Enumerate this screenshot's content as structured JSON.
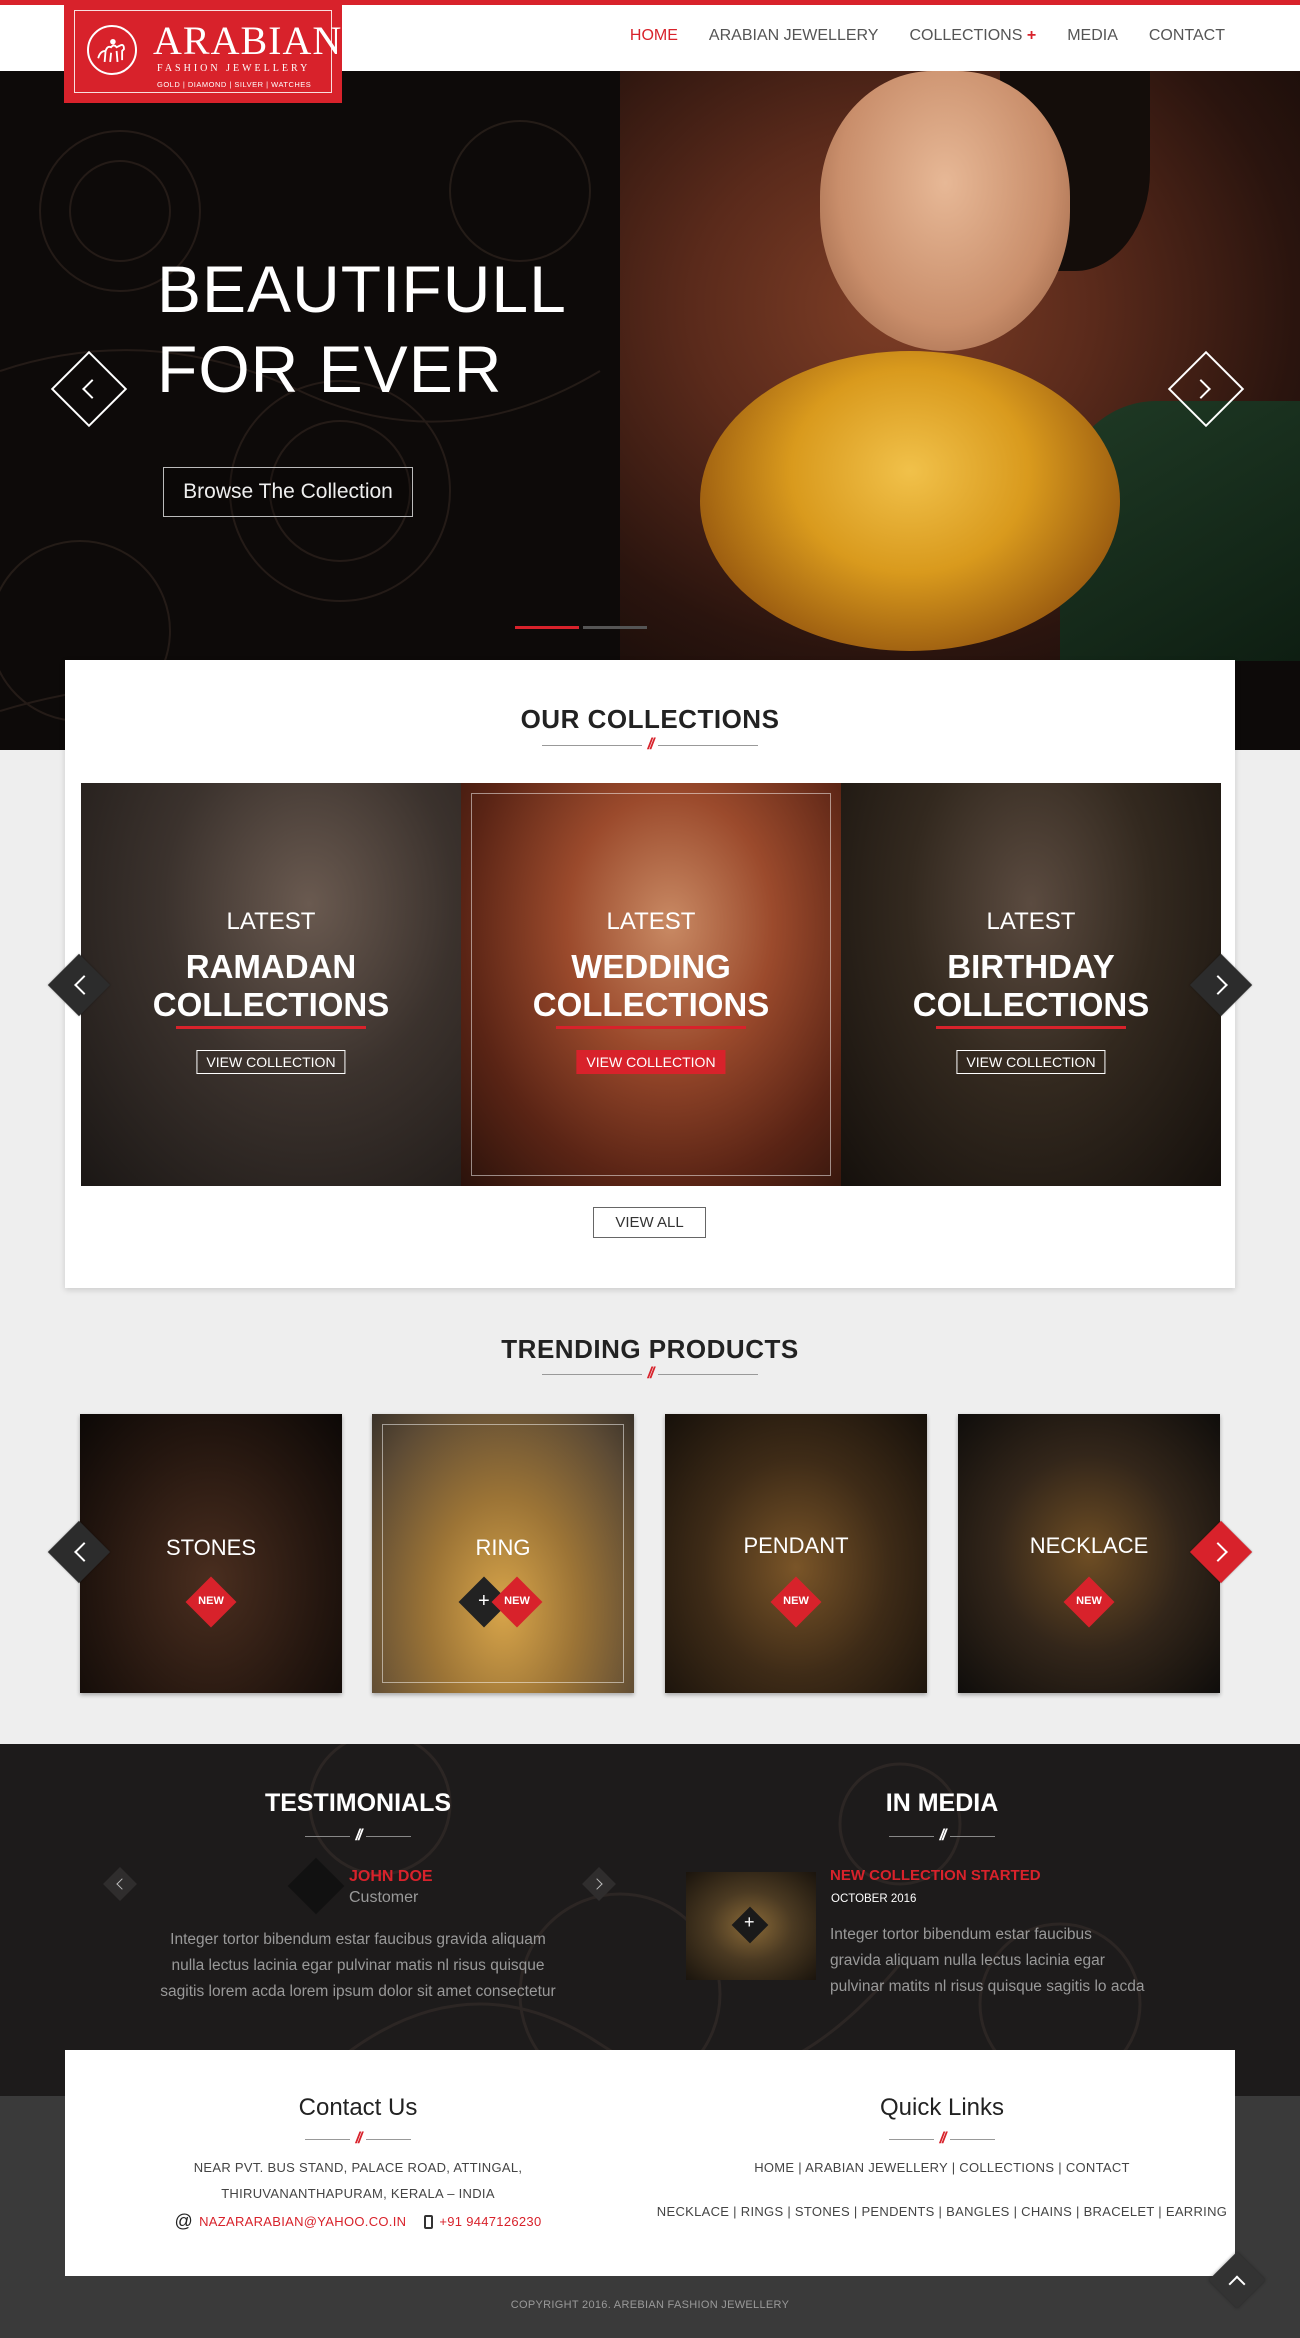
{
  "brand": {
    "name": "ARABIAN",
    "subtitle": "FASHION JEWELLERY",
    "tags": "GOLD | DIAMOND | SILVER | WATCHES"
  },
  "nav": {
    "items": [
      {
        "label": "HOME",
        "active": true
      },
      {
        "label": "ARABIAN JEWELLERY",
        "active": false
      },
      {
        "label": "COLLECTIONS",
        "active": false,
        "suffix": "+"
      },
      {
        "label": "MEDIA",
        "active": false
      },
      {
        "label": "CONTACT",
        "active": false
      }
    ]
  },
  "hero": {
    "title_line1": "BEAUTIFULL",
    "title_line2": "FOR EVER",
    "button": "Browse The Collection",
    "slide_count": 3,
    "active_slide": 1
  },
  "collections": {
    "title": "OUR COLLECTIONS",
    "divider": "//",
    "cards": [
      {
        "kicker": "LATEST",
        "line1": "RAMADAN",
        "line2": "COLLECTIONS",
        "button": "VIEW COLLECTION",
        "highlighted": false
      },
      {
        "kicker": "LATEST",
        "line1": "WEDDING",
        "line2": "COLLECTIONS",
        "button": "VIEW COLLECTION",
        "highlighted": true
      },
      {
        "kicker": "LATEST",
        "line1": "BIRTHDAY",
        "line2": "COLLECTIONS",
        "button": "VIEW COLLECTION",
        "highlighted": false
      }
    ],
    "view_all": "VIEW ALL"
  },
  "trending": {
    "title": "TRENDING PRODUCTS",
    "divider": "//",
    "products": [
      {
        "label": "STONES",
        "badge": "NEW"
      },
      {
        "label": "RING",
        "badge": "NEW",
        "plus": "+"
      },
      {
        "label": "PENDANT",
        "badge": "NEW"
      },
      {
        "label": "NECKLACE",
        "badge": "NEW"
      }
    ]
  },
  "testimonials": {
    "title": "TESTIMONIALS",
    "divider": "//",
    "name": "JOHN DOE",
    "role": "Customer",
    "text_line1": "Integer tortor bibendum estar faucibus gravida aliquam",
    "text_line2": "nulla lectus lacinia egar pulvinar matis nl risus quisque",
    "text_line3": "sagitis lorem acda lorem ipsum dolor sit amet consectetur"
  },
  "media": {
    "title": "IN MEDIA",
    "divider": "//",
    "headline": "NEW COLLECTION STARTED",
    "date": "OCTOBER 2016",
    "plus": "+",
    "text_line1": "Integer tortor bibendum estar faucibus",
    "text_line2": "gravida aliquam nulla lectus lacinia egar",
    "text_line3": "pulvinar matits nl risus quisque sagitis lo acda"
  },
  "contact": {
    "title": "Contact Us",
    "divider": "//",
    "address_line1": "NEAR PVT. BUS STAND, PALACE ROAD, ATTINGAL,",
    "address_line2": "THIRUVANANTHAPURAM, KERALA – INDIA",
    "email_icon": "@",
    "email": "NAZARARABIAN@YAHOO.CO.IN",
    "phone": "+91 9447126230"
  },
  "quick_links": {
    "title": "Quick Links",
    "divider": "//",
    "row1": "HOME | ARABIAN JEWELLERY |  COLLECTIONS | CONTACT",
    "row2": "NECKLACE | RINGS |  STONES | PENDENTS | BANGLES | CHAINS | BRACELET | EARRING"
  },
  "footer": {
    "copyright": "COPYRIGHT 2016.  AREBIAN FASHION JEWELLERY"
  },
  "colors": {
    "accent": "#d8222b",
    "dark_band": "#1d1b1b",
    "footer_dark": "#3a3a3a",
    "background": "#eeeeee"
  }
}
